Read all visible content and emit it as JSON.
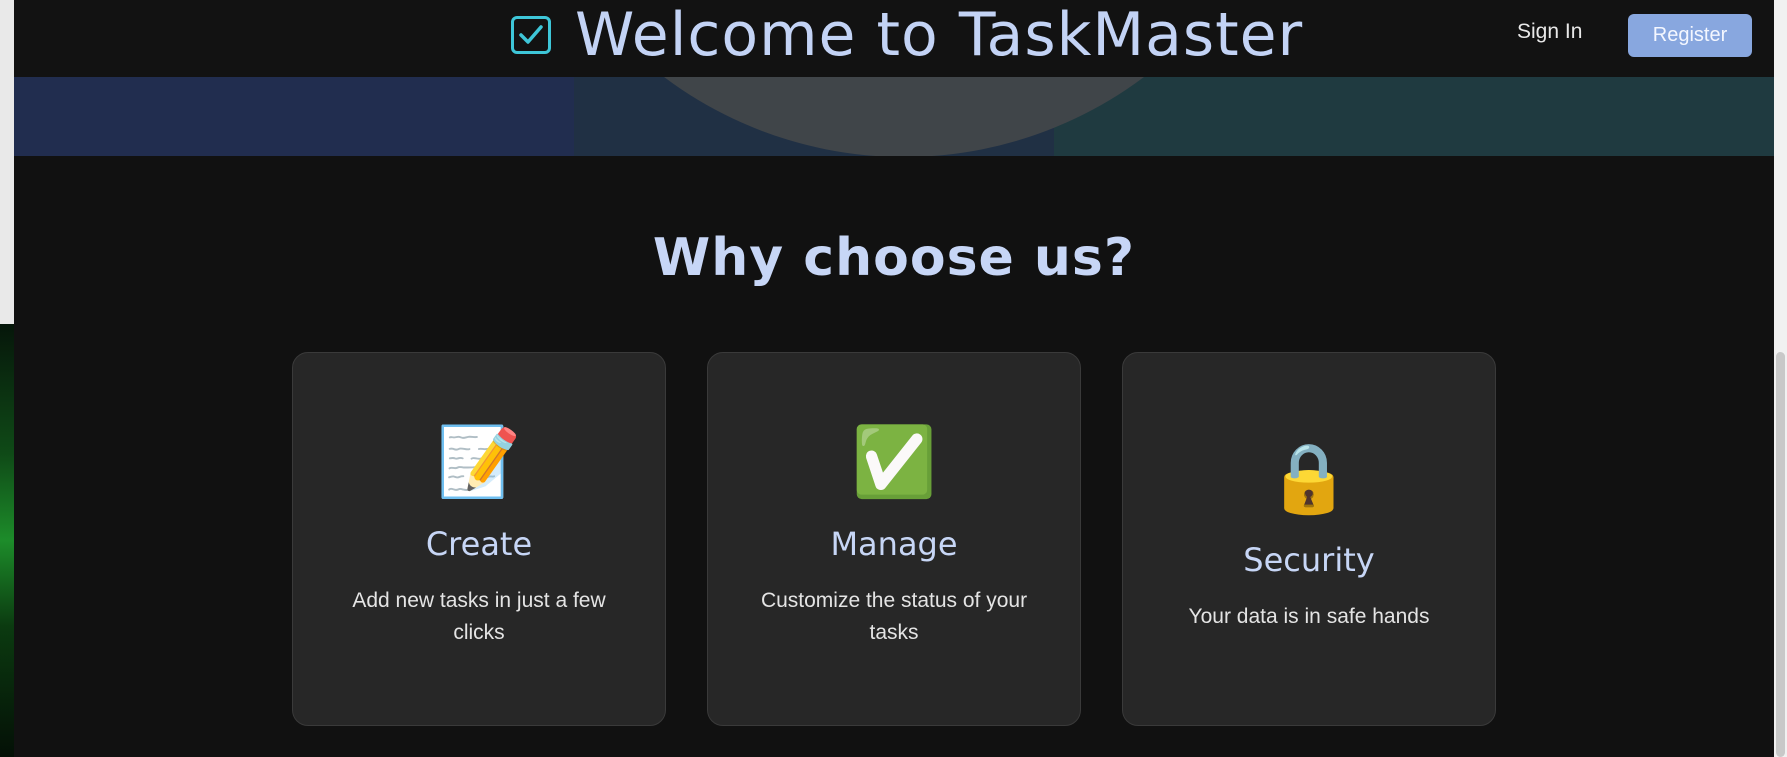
{
  "navbar": {
    "brand_title": "Welcome to TaskMaster",
    "brand_icon": "checkbox-icon",
    "signin_label": "Sign In",
    "register_label": "Register"
  },
  "features": {
    "title": "Why choose us?",
    "cards": [
      {
        "icon": "memo-pencil-icon",
        "emoji": "📝",
        "title": "Create",
        "description": "Add new tasks in just a few clicks"
      },
      {
        "icon": "check-mark-button-icon",
        "emoji": "✅",
        "title": "Manage",
        "description": "Customize the status of your tasks"
      },
      {
        "icon": "lock-icon",
        "emoji": "🔒",
        "title": "Security",
        "description": "Your data is in safe hands"
      }
    ]
  },
  "colors": {
    "background": "#111111",
    "accent": "#88a7df",
    "heading": "#c7d6f6",
    "card": "#272727",
    "check_icon": "#3ec6d8"
  }
}
